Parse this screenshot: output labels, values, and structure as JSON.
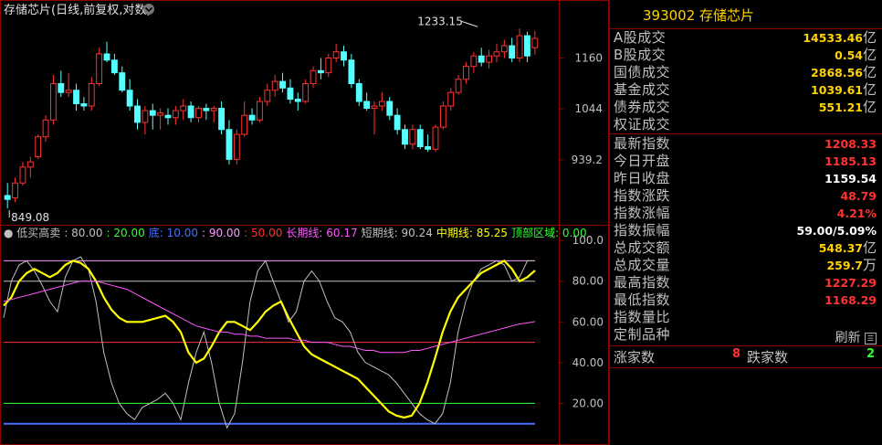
{
  "title": {
    "text": "存储芯片(日线,前复权,对数)",
    "chevron": "chevron-down-icon"
  },
  "panel": {
    "code": "393002",
    "name": "存储芯片",
    "rows": [
      {
        "label": "A股成交",
        "value": "14533.46",
        "unit": "亿",
        "color": "#ffd200"
      },
      {
        "label": "B股成交",
        "value": "0.54",
        "unit": "亿",
        "color": "#ffd200"
      },
      {
        "label": "国债成交",
        "value": "2868.56",
        "unit": "亿",
        "color": "#ffd200"
      },
      {
        "label": "基金成交",
        "value": "1039.61",
        "unit": "亿",
        "color": "#ffd200"
      },
      {
        "label": "债券成交",
        "value": "551.21",
        "unit": "亿",
        "color": "#ffd200"
      },
      {
        "label": "权证成交",
        "value": "",
        "unit": "",
        "color": "#ffd200"
      }
    ],
    "rows2": [
      {
        "label": "最新指数",
        "value": "1208.33",
        "unit": "",
        "color": "#ff3232"
      },
      {
        "label": "今日开盘",
        "value": "1185.13",
        "unit": "",
        "color": "#ff3232"
      },
      {
        "label": "昨日收盘",
        "value": "1159.54",
        "unit": "",
        "color": "#ffffff"
      },
      {
        "label": "指数涨跌",
        "value": "48.79",
        "unit": "",
        "color": "#ff3232"
      },
      {
        "label": "指数涨幅",
        "value": "4.21%",
        "unit": "",
        "color": "#ff3232"
      },
      {
        "label": "指数振幅",
        "value": "59.00/5.09%",
        "unit": "",
        "color": "#ffffff"
      },
      {
        "label": "总成交额",
        "value": "548.37",
        "unit": "亿",
        "color": "#ffd200"
      },
      {
        "label": "总成交量",
        "value": "259.7",
        "unit": "万",
        "color": "#ffd200"
      },
      {
        "label": "最高指数",
        "value": "1227.29",
        "unit": "",
        "color": "#ff3232"
      },
      {
        "label": "最低指数",
        "value": "1168.29",
        "unit": "",
        "color": "#ff3232"
      },
      {
        "label": "指数量比",
        "value": "",
        "unit": "",
        "color": "#ffffff"
      },
      {
        "label": "定制品种",
        "value": "",
        "unit": "",
        "color": "#ffffff"
      }
    ],
    "refresh_label": "刷新",
    "refresh_icon": "refresh-icon",
    "up_label": "涨家数",
    "up_value": "8",
    "down_label": "跌家数",
    "down_value": "2",
    "up_color": "#ff3232",
    "down_color": "#32ff32"
  },
  "chart_data": [
    {
      "type": "candlestick",
      "title": "存储芯片(日线,前复权,对数)",
      "yscale": "log",
      "ylim": [
        830,
        1255
      ],
      "yticks": [
        939.2,
        1044,
        1160
      ],
      "ytick_labels": [
        "939.2",
        "1044",
        "1160"
      ],
      "annotations": [
        {
          "text": "1233.15",
          "at": "high",
          "index": 62,
          "value": 1233.15
        },
        {
          "text": "849.08",
          "at": "low",
          "index": 0,
          "value": 849.08
        }
      ],
      "up_color": "#ff3232",
      "down_color": "#54ffff",
      "candles": [
        {
          "o": 872,
          "h": 895,
          "l": 849.08,
          "c": 865
        },
        {
          "o": 868,
          "h": 905,
          "l": 860,
          "c": 895
        },
        {
          "o": 895,
          "h": 935,
          "l": 890,
          "c": 925
        },
        {
          "o": 925,
          "h": 945,
          "l": 905,
          "c": 935
        },
        {
          "o": 945,
          "h": 990,
          "l": 940,
          "c": 985
        },
        {
          "o": 985,
          "h": 1030,
          "l": 975,
          "c": 1020
        },
        {
          "o": 1020,
          "h": 1120,
          "l": 1010,
          "c": 1100
        },
        {
          "o": 1100,
          "h": 1130,
          "l": 1070,
          "c": 1080
        },
        {
          "o": 1080,
          "h": 1125,
          "l": 1070,
          "c": 1085
        },
        {
          "o": 1085,
          "h": 1100,
          "l": 1040,
          "c": 1055
        },
        {
          "o": 1055,
          "h": 1070,
          "l": 1040,
          "c": 1050
        },
        {
          "o": 1050,
          "h": 1115,
          "l": 1040,
          "c": 1100
        },
        {
          "o": 1100,
          "h": 1185,
          "l": 1095,
          "c": 1170
        },
        {
          "o": 1170,
          "h": 1200,
          "l": 1150,
          "c": 1155
        },
        {
          "o": 1155,
          "h": 1170,
          "l": 1120,
          "c": 1125
        },
        {
          "o": 1125,
          "h": 1140,
          "l": 1080,
          "c": 1085
        },
        {
          "o": 1085,
          "h": 1110,
          "l": 1040,
          "c": 1050
        },
        {
          "o": 1050,
          "h": 1065,
          "l": 1000,
          "c": 1015
        },
        {
          "o": 1015,
          "h": 1050,
          "l": 990,
          "c": 1040
        },
        {
          "o": 1040,
          "h": 1055,
          "l": 1000,
          "c": 1030
        },
        {
          "o": 1030,
          "h": 1045,
          "l": 1000,
          "c": 1035
        },
        {
          "o": 1030,
          "h": 1045,
          "l": 1010,
          "c": 1025
        },
        {
          "o": 1025,
          "h": 1050,
          "l": 1010,
          "c": 1040
        },
        {
          "o": 1040,
          "h": 1065,
          "l": 1020,
          "c": 1050
        },
        {
          "o": 1050,
          "h": 1060,
          "l": 1015,
          "c": 1025
        },
        {
          "o": 1025,
          "h": 1050,
          "l": 1015,
          "c": 1045
        },
        {
          "o": 1045,
          "h": 1055,
          "l": 1020,
          "c": 1040
        },
        {
          "o": 1040,
          "h": 1050,
          "l": 1015,
          "c": 1045
        },
        {
          "o": 1045,
          "h": 1060,
          "l": 990,
          "c": 1000
        },
        {
          "o": 1000,
          "h": 1020,
          "l": 930,
          "c": 940
        },
        {
          "o": 940,
          "h": 1000,
          "l": 930,
          "c": 990
        },
        {
          "o": 990,
          "h": 1060,
          "l": 985,
          "c": 1030
        },
        {
          "o": 1030,
          "h": 1045,
          "l": 1010,
          "c": 1020
        },
        {
          "o": 1020,
          "h": 1070,
          "l": 1015,
          "c": 1060
        },
        {
          "o": 1060,
          "h": 1100,
          "l": 1050,
          "c": 1085
        },
        {
          "o": 1085,
          "h": 1120,
          "l": 1070,
          "c": 1105
        },
        {
          "o": 1105,
          "h": 1125,
          "l": 1080,
          "c": 1090
        },
        {
          "o": 1090,
          "h": 1110,
          "l": 1055,
          "c": 1065
        },
        {
          "o": 1065,
          "h": 1080,
          "l": 1040,
          "c": 1060
        },
        {
          "o": 1060,
          "h": 1110,
          "l": 1055,
          "c": 1100
        },
        {
          "o": 1100,
          "h": 1140,
          "l": 1090,
          "c": 1130
        },
        {
          "o": 1130,
          "h": 1160,
          "l": 1110,
          "c": 1125
        },
        {
          "o": 1125,
          "h": 1170,
          "l": 1115,
          "c": 1160
        },
        {
          "o": 1160,
          "h": 1195,
          "l": 1150,
          "c": 1175
        },
        {
          "o": 1175,
          "h": 1190,
          "l": 1140,
          "c": 1155
        },
        {
          "o": 1155,
          "h": 1170,
          "l": 1090,
          "c": 1100
        },
        {
          "o": 1100,
          "h": 1110,
          "l": 1050,
          "c": 1060
        },
        {
          "o": 1060,
          "h": 1080,
          "l": 1040,
          "c": 1045
        },
        {
          "o": 1045,
          "h": 1060,
          "l": 990,
          "c": 1050
        },
        {
          "o": 1050,
          "h": 1080,
          "l": 1040,
          "c": 1060
        },
        {
          "o": 1060,
          "h": 1070,
          "l": 1020,
          "c": 1030
        },
        {
          "o": 1030,
          "h": 1045,
          "l": 990,
          "c": 1000
        },
        {
          "o": 1000,
          "h": 1010,
          "l": 960,
          "c": 970
        },
        {
          "o": 970,
          "h": 1010,
          "l": 960,
          "c": 1000
        },
        {
          "o": 1000,
          "h": 1010,
          "l": 960,
          "c": 965
        },
        {
          "o": 965,
          "h": 990,
          "l": 955,
          "c": 960
        },
        {
          "o": 960,
          "h": 1010,
          "l": 955,
          "c": 1005
        },
        {
          "o": 1005,
          "h": 1060,
          "l": 1000,
          "c": 1050
        },
        {
          "o": 1050,
          "h": 1090,
          "l": 1040,
          "c": 1080
        },
        {
          "o": 1080,
          "h": 1120,
          "l": 1075,
          "c": 1110
        },
        {
          "o": 1110,
          "h": 1150,
          "l": 1100,
          "c": 1140
        },
        {
          "o": 1140,
          "h": 1175,
          "l": 1125,
          "c": 1165
        },
        {
          "o": 1165,
          "h": 1185,
          "l": 1140,
          "c": 1150
        },
        {
          "o": 1150,
          "h": 1180,
          "l": 1135,
          "c": 1165
        },
        {
          "o": 1165,
          "h": 1195,
          "l": 1150,
          "c": 1175
        },
        {
          "o": 1175,
          "h": 1205,
          "l": 1160,
          "c": 1190
        },
        {
          "o": 1190,
          "h": 1210,
          "l": 1150,
          "c": 1160
        },
        {
          "o": 1160,
          "h": 1233.15,
          "l": 1150,
          "c": 1215
        },
        {
          "o": 1215,
          "h": 1225,
          "l": 1150,
          "c": 1165
        },
        {
          "o": 1185.13,
          "h": 1227.29,
          "l": 1168.29,
          "c": 1208.33
        }
      ]
    },
    {
      "type": "line",
      "title": "低买高卖",
      "legend": [
        {
          "text": "低买高卖",
          "color": "#c0c0c0"
        },
        {
          "text": ": 80.00",
          "color": "#c0c0c0"
        },
        {
          "text": ": 20.00",
          "color": "#32ff32"
        },
        {
          "text": "底: 10.00",
          "color": "#4a6cff"
        },
        {
          "text": ": 90.00",
          "color": "#ff9aff"
        },
        {
          "text": ": 50.00",
          "color": "#ff3232"
        },
        {
          "text": "长期线: 60.17",
          "color": "#ff56ff"
        },
        {
          "text": "短期线: 90.24",
          "color": "#c0c0c0"
        },
        {
          "text": "中期线: 85.25",
          "color": "#ffff00"
        },
        {
          "text": "顶部区域: 0.00",
          "color": "#32ff32"
        }
      ],
      "ylim": [
        0,
        105
      ],
      "yticks": [
        20,
        40,
        60,
        80,
        100
      ],
      "ytick_labels": [
        "20.00",
        "40.00",
        "60.00",
        "80.00",
        "100.0"
      ],
      "hlines": [
        {
          "value": 90,
          "color": "#ff9aff"
        },
        {
          "value": 80,
          "color": "#c0c0c0"
        },
        {
          "value": 50,
          "color": "#ff3232"
        },
        {
          "value": 20,
          "color": "#32ff32"
        },
        {
          "value": 10,
          "color": "#4a6cff"
        }
      ],
      "series": [
        {
          "color": "#c0c0c0",
          "values": [
            62,
            80,
            88,
            90,
            85,
            78,
            70,
            65,
            82,
            90,
            92,
            86,
            70,
            45,
            30,
            20,
            15,
            12,
            18,
            20,
            22,
            25,
            20,
            12,
            30,
            45,
            55,
            40,
            20,
            8,
            15,
            40,
            70,
            85,
            90,
            80,
            70,
            60,
            65,
            80,
            85,
            80,
            70,
            62,
            60,
            55,
            45,
            40,
            38,
            36,
            34,
            30,
            25,
            20,
            15,
            12,
            10,
            15,
            30,
            55,
            70,
            80,
            86,
            88,
            90,
            88,
            80,
            82,
            90,
            90
          ]
        },
        {
          "color": "#ffff00",
          "values": [
            68,
            72,
            80,
            84,
            86,
            84,
            82,
            84,
            88,
            90,
            89,
            86,
            80,
            72,
            66,
            62,
            60,
            60,
            60,
            61,
            62,
            63,
            60,
            55,
            45,
            40,
            42,
            48,
            55,
            60,
            60,
            58,
            56,
            60,
            65,
            68,
            70,
            62,
            55,
            48,
            44,
            42,
            40,
            38,
            36,
            34,
            32,
            28,
            24,
            20,
            16,
            14,
            13,
            14,
            20,
            30,
            42,
            55,
            65,
            72,
            76,
            80,
            84,
            86,
            88,
            90,
            86,
            80,
            82,
            85.25
          ]
        },
        {
          "color": "#ff56ff",
          "values": [
            70,
            71,
            72,
            73,
            74,
            75,
            76,
            77,
            78,
            79,
            80,
            80,
            80,
            79,
            78,
            77,
            76,
            74,
            72,
            70,
            68,
            66,
            64,
            62,
            60,
            58,
            57,
            56,
            55,
            55,
            54,
            54,
            53,
            53,
            52,
            52,
            52,
            52,
            51,
            51,
            50,
            50,
            50,
            49,
            48,
            48,
            47,
            46,
            46,
            45,
            45,
            45,
            45,
            46,
            46,
            47,
            48,
            49,
            50,
            51,
            52,
            53,
            54,
            55,
            56,
            57,
            58,
            59,
            59.5,
            60.17
          ]
        }
      ]
    }
  ]
}
